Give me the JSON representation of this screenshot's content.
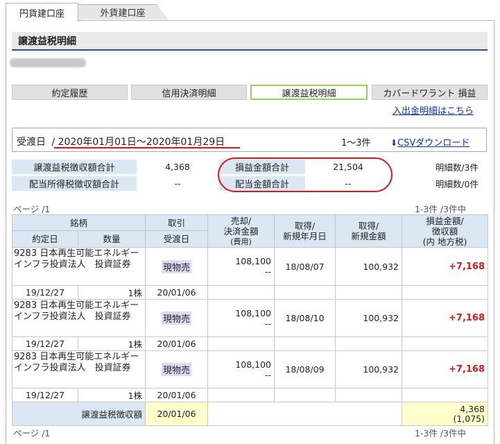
{
  "tabs": {
    "active": "円貨建口座",
    "inactive": "外貨建口座"
  },
  "page_title": "譲渡益税明細",
  "subtabs": [
    "約定履歴",
    "信用決済明細",
    "譲渡益税明細",
    "カバードワラント 損益"
  ],
  "cash_link": "入出金明細はこちら",
  "filter": {
    "label": "受渡日",
    "range": "/ 2020年01月01日～2020年01月29日",
    "count": "1～3件",
    "csv": "CSVダウンロード"
  },
  "summary": {
    "r1": {
      "label1": "譲渡益税徴収額合計",
      "val1": "4,368",
      "label2": "損益金額合計",
      "val2": "21,504",
      "count": "明細数/3件"
    },
    "r2": {
      "label1": "配当所得税徴収額合計",
      "val1": "--",
      "label2": "配当金額合計",
      "val2": "--",
      "count": "明細数/0件"
    }
  },
  "pager": {
    "left": "ページ /1",
    "right": "1-3件 /3件中"
  },
  "table": {
    "h_issue": "銘柄",
    "h_date": "約定日",
    "h_qty": "数量",
    "h_trade": "取引",
    "h_delivery": "受渡日",
    "h_sale_1": "売却/",
    "h_sale_2": "決済金額",
    "h_sale_3": "(費用)",
    "h_acq_date_1": "取得/",
    "h_acq_date_2": "新規年月日",
    "h_acq_amt_1": "取得/",
    "h_acq_amt_2": "新規金額",
    "h_pl_1": "損益金額/",
    "h_pl_2": "徴収額",
    "h_pl_3": "(内 地方税)",
    "rows": [
      {
        "issue": "9283 日本再生可能エネルギーインフラ投資法人　投資証券",
        "trade": "現物売",
        "sale": "108,100",
        "cost": "--",
        "acq_date": "18/08/07",
        "acq_amt": "100,932",
        "pl": "+7,168",
        "date": "19/12/27",
        "qty": "1株",
        "delivery": "20/01/06"
      },
      {
        "issue": "9283 日本再生可能エネルギーインフラ投資法人　投資証券",
        "trade": "現物売",
        "sale": "108,100",
        "cost": "--",
        "acq_date": "18/08/10",
        "acq_amt": "100,932",
        "pl": "+7,168",
        "date": "19/12/27",
        "qty": "1株",
        "delivery": "20/01/06"
      },
      {
        "issue": "9283 日本再生可能エネルギーインフラ投資法人　投資証券",
        "trade": "現物売",
        "sale": "108,100",
        "cost": "--",
        "acq_date": "18/08/09",
        "acq_amt": "100,932",
        "pl": "+7,168",
        "date": "19/12/27",
        "qty": "1株",
        "delivery": "20/01/06"
      }
    ],
    "footer": {
      "label": "譲渡益税徴収額",
      "date": "20/01/06",
      "amount": "4,368",
      "local": "(1,075)"
    }
  }
}
